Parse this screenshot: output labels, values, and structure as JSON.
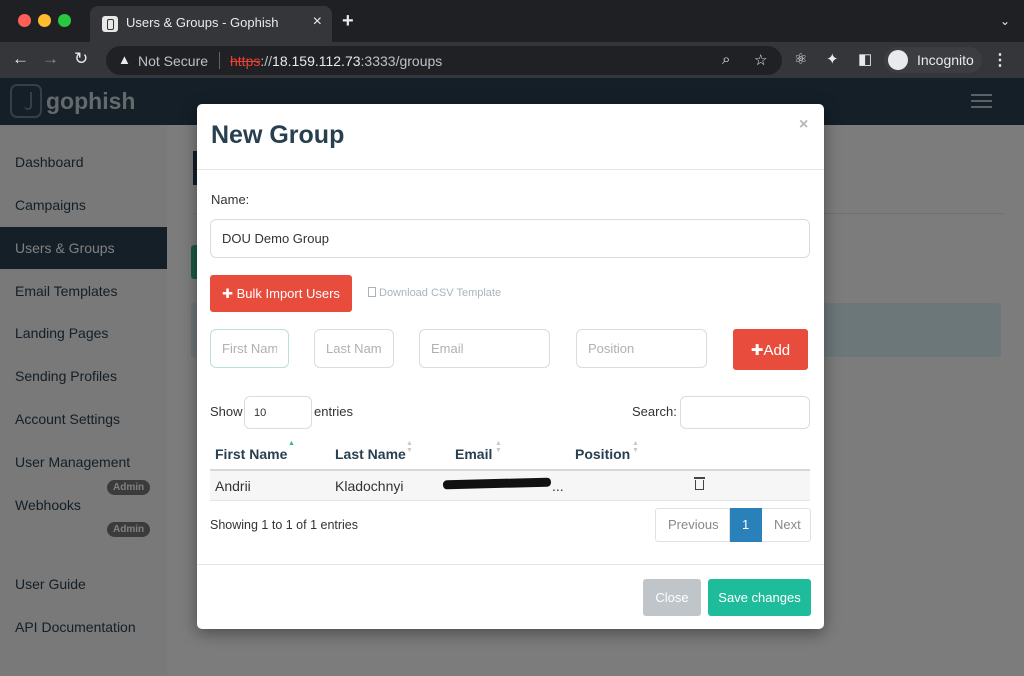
{
  "browser": {
    "tab_title": "Users & Groups - Gophish",
    "tab_close": "×",
    "new_tab": "+",
    "tab_menu": "⌄",
    "security_label": "Not Secure",
    "url_protocol": "https",
    "url_protocol_sep": "://",
    "url_host": "18.159.112.73",
    "url_rest": ":3333/groups",
    "profile_label": "Incognito",
    "menu": "⋮"
  },
  "app": {
    "logo_text": "gophish"
  },
  "sidebar": {
    "items": [
      {
        "label": "Dashboard"
      },
      {
        "label": "Campaigns"
      },
      {
        "label": "Users & Groups"
      },
      {
        "label": "Email Templates"
      },
      {
        "label": "Landing Pages"
      },
      {
        "label": "Sending Profiles"
      },
      {
        "label": "Account Settings"
      },
      {
        "label": "User Management"
      },
      {
        "label": "Webhooks"
      },
      {
        "label": "User Guide"
      },
      {
        "label": "API Documentation"
      }
    ],
    "active_item": "Users & Groups",
    "admin_badge": "Admin"
  },
  "modal": {
    "title": "New Group",
    "close_x": "×",
    "name_label": "Name:",
    "name_value": "DOU Demo Group",
    "bulk_import_label": "Bulk Import Users",
    "download_csv_label": "Download CSV Template",
    "first_name_placeholder": "First Name",
    "last_name_placeholder": "Last Name",
    "email_placeholder": "Email",
    "position_placeholder": "Position",
    "add_label": "Add",
    "plus": "✚",
    "show_label": "Show",
    "page_length": "10",
    "entries_label": "entries",
    "search_label": "Search:",
    "search_value": "",
    "columns": [
      "First Name",
      "Last Name",
      "Email",
      "Position"
    ],
    "rows": [
      {
        "first_name": "Andrii",
        "last_name": "Kladochnyi",
        "email_suffix": "...",
        "position": ""
      }
    ],
    "info_text": "Showing 1 to 1 of 1 entries",
    "pagination": {
      "previous": "Previous",
      "current": "1",
      "next": "Next"
    },
    "close_button": "Close",
    "save_button": "Save changes"
  },
  "colors": {
    "brand": "#283f50",
    "danger": "#e74c3c",
    "success": "#1fbc9c",
    "primary": "#2a80b9"
  }
}
